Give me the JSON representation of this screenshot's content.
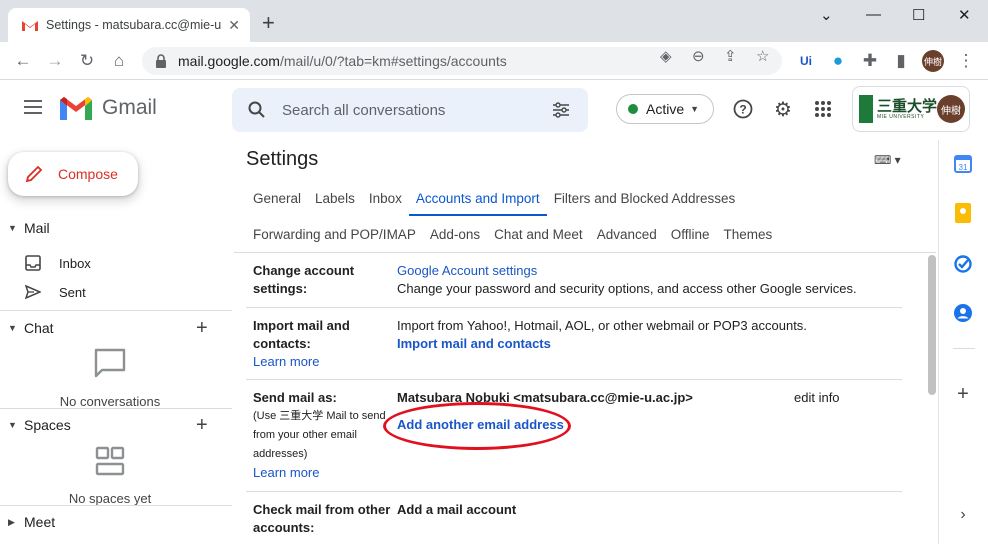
{
  "browser": {
    "tab_title": "Settings - matsubara.cc@mie-u.a",
    "url_host": "mail.google.com",
    "url_path": "/mail/u/0/?tab=km#settings/accounts",
    "profile_initials": "伸樹"
  },
  "header": {
    "app_name": "Gmail",
    "search_placeholder": "Search all conversations",
    "status_label": "Active",
    "university_name": "三重大学",
    "university_sub": "MIE UNIVERSITY",
    "account_initials": "伸樹"
  },
  "nav": {
    "compose_label": "Compose",
    "mail_section": "Mail",
    "inbox_label": "Inbox",
    "sent_label": "Sent",
    "chat_section": "Chat",
    "chat_empty": "No conversations",
    "spaces_section": "Spaces",
    "spaces_empty": "No spaces yet",
    "meet_section": "Meet"
  },
  "settings": {
    "title": "Settings",
    "tabs_row1": [
      "General",
      "Labels",
      "Inbox",
      "Accounts and Import",
      "Filters and Blocked Addresses"
    ],
    "tabs_row2": [
      "Forwarding and POP/IMAP",
      "Add-ons",
      "Chat and Meet",
      "Advanced",
      "Offline",
      "Themes"
    ],
    "active_tab": "Accounts and Import",
    "rows": {
      "change_account": {
        "label_l1": "Change account",
        "label_l2": "settings:",
        "link": "Google Account settings",
        "desc": "Change your password and security options, and access other Google services."
      },
      "import_mail": {
        "label_l1": "Import mail and",
        "label_l2": "contacts:",
        "learn_more": "Learn more",
        "desc": "Import from Yahoo!, Hotmail, AOL, or other webmail or POP3 accounts.",
        "link": "Import mail and contacts"
      },
      "send_mail": {
        "label": "Send mail as:",
        "note_l1": "(Use 三重大学 Mail to send",
        "note_l2": "from your other email",
        "note_l3": "addresses)",
        "learn_more": "Learn more",
        "identity": "Matsubara Nobuki <matsubara.cc@mie-u.ac.jp>",
        "edit_info": "edit info",
        "add_link": "Add another email address"
      },
      "check_mail": {
        "label_l1": "Check mail from other",
        "label_l2": "accounts:",
        "link": "Add a mail account"
      }
    }
  },
  "colors": {
    "accent_blue": "#0b57d0",
    "link_blue": "#1a56c8",
    "compose_red": "#d93025",
    "annotation_red": "#e0101f",
    "active_green": "#1e8e3e"
  }
}
